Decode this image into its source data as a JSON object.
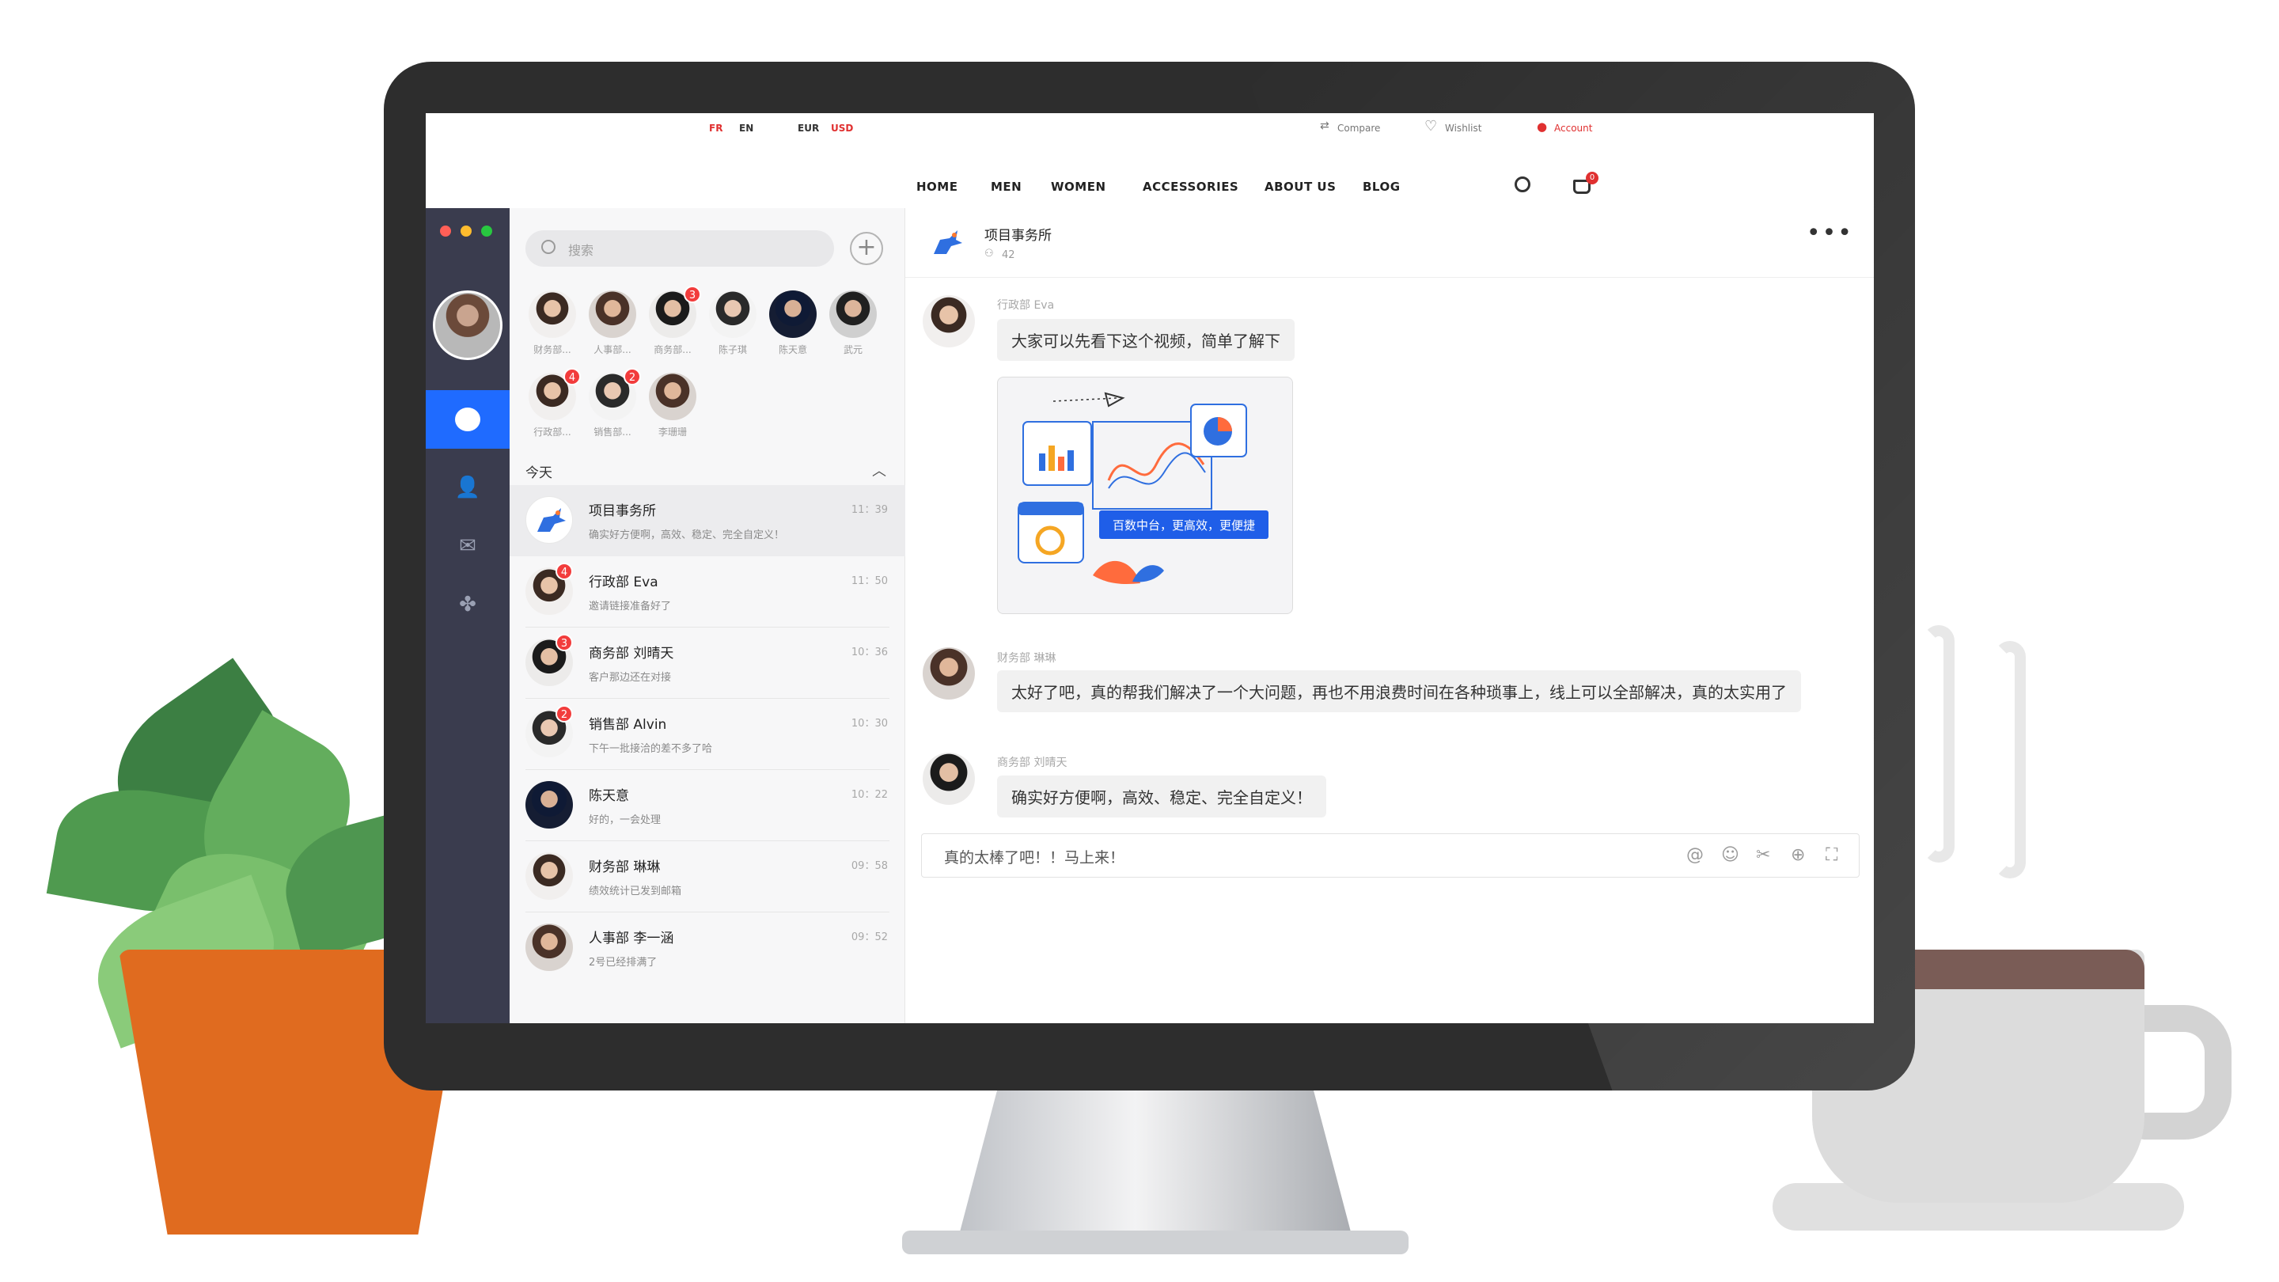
{
  "top_bar": {
    "lang_fr": "FR",
    "lang_en": "EN",
    "cur_eur": "EUR",
    "cur_usd": "USD",
    "compare": "Compare",
    "wishlist": "Wishlist",
    "account": "Account"
  },
  "nav": {
    "items": [
      "HOME",
      "MEN",
      "WOMEN",
      "ACCESSORIES",
      "ABOUT US",
      "BLOG"
    ],
    "active": "MEN",
    "cart_count": "0"
  },
  "app": {
    "search_placeholder": "搜索",
    "contacts": [
      {
        "name": "财务部...",
        "badge": ""
      },
      {
        "name": "人事部...",
        "badge": ""
      },
      {
        "name": "商务部...",
        "badge": "3"
      },
      {
        "name": "陈子琪",
        "badge": ""
      },
      {
        "name": "陈天意",
        "badge": ""
      },
      {
        "name": "武元",
        "badge": ""
      },
      {
        "name": "行政部...",
        "badge": "4"
      },
      {
        "name": "销售部...",
        "badge": "2"
      },
      {
        "name": "李珊珊",
        "badge": ""
      }
    ],
    "section_label": "今天",
    "conversations": [
      {
        "name": "项目事务所",
        "preview": "确实好方便啊，高效、稳定、完全自定义！",
        "time": "11：39",
        "badge": ""
      },
      {
        "name": "行政部 Eva",
        "preview": "邀请链接准备好了",
        "time": "11：50",
        "badge": "4"
      },
      {
        "name": "商务部 刘晴天",
        "preview": "客户那边还在对接",
        "time": "10：36",
        "badge": "3"
      },
      {
        "name": "销售部 Alvin",
        "preview": "下午一批接洽的差不多了哈",
        "time": "10：30",
        "badge": "2"
      },
      {
        "name": "陈天意",
        "preview": "好的，一会处理",
        "time": "10：22",
        "badge": ""
      },
      {
        "name": "财务部 琳琳",
        "preview": "绩效统计已发到邮箱",
        "time": "09：58",
        "badge": ""
      },
      {
        "name": "人事部 李一涵",
        "preview": "2号已经排满了",
        "time": "09：52",
        "badge": ""
      }
    ],
    "chat": {
      "title": "项目事务所",
      "members": "42",
      "messages": [
        {
          "sender": "行政部 Eva",
          "text": "大家可以先看下这个视频，简单了解下"
        },
        {
          "sender": "财务部 琳琳",
          "text": "太好了吧，真的帮我们解决了一个大问题，再也不用浪费时间在各种琐事上，线上可以全部解决，真的太实用了"
        },
        {
          "sender": "商务部 刘晴天",
          "text": "确实好方便啊，高效、稳定、完全自定义！"
        }
      ],
      "media_caption": "百数中台，更高效，更便捷",
      "composer_text": "真的太棒了吧！！马上来！"
    }
  },
  "colors": {
    "accent": "#1f6bff",
    "rail": "#3a3c4e",
    "badge": "#f23c3c",
    "nav_active": "#e03030"
  }
}
